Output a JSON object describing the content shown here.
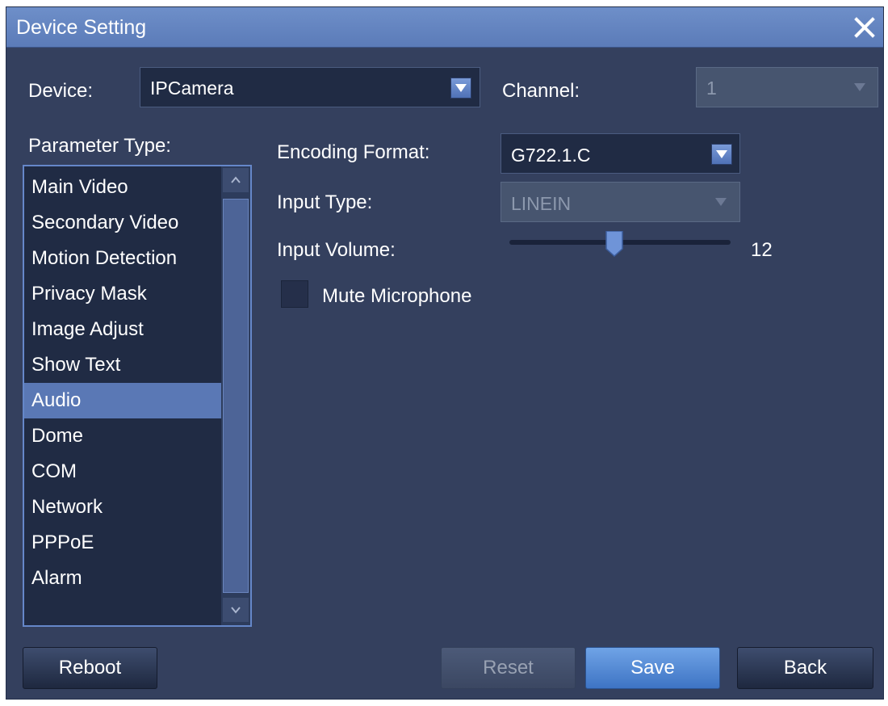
{
  "window": {
    "title": "Device Setting"
  },
  "device": {
    "label": "Device:",
    "value": "IPCamera"
  },
  "channel": {
    "label": "Channel:",
    "value": "1"
  },
  "parameter_type": {
    "label": "Parameter Type:",
    "items": [
      {
        "label": "Main Video"
      },
      {
        "label": "Secondary Video"
      },
      {
        "label": "Motion Detection"
      },
      {
        "label": "Privacy Mask"
      },
      {
        "label": "Image Adjust"
      },
      {
        "label": "Show Text"
      },
      {
        "label": "Audio"
      },
      {
        "label": "Dome"
      },
      {
        "label": "COM"
      },
      {
        "label": "Network"
      },
      {
        "label": "PPPoE"
      },
      {
        "label": "Alarm"
      }
    ],
    "selected": "Audio"
  },
  "audio": {
    "encoding_format": {
      "label": "Encoding Format:",
      "value": "G722.1.C"
    },
    "input_type": {
      "label": "Input Type:",
      "value": "LINEIN"
    },
    "input_volume": {
      "label": "Input Volume:",
      "value": "12"
    },
    "mute_microphone": {
      "label": "Mute Microphone",
      "checked": false
    }
  },
  "buttons": {
    "reboot": "Reboot",
    "reset": "Reset",
    "save": "Save",
    "back": "Back"
  },
  "colors": {
    "panel_bg": "#34405e",
    "titlebar": "#6e8fc9",
    "selection": "#5a78b5",
    "primary_button": "#4f86d3"
  }
}
